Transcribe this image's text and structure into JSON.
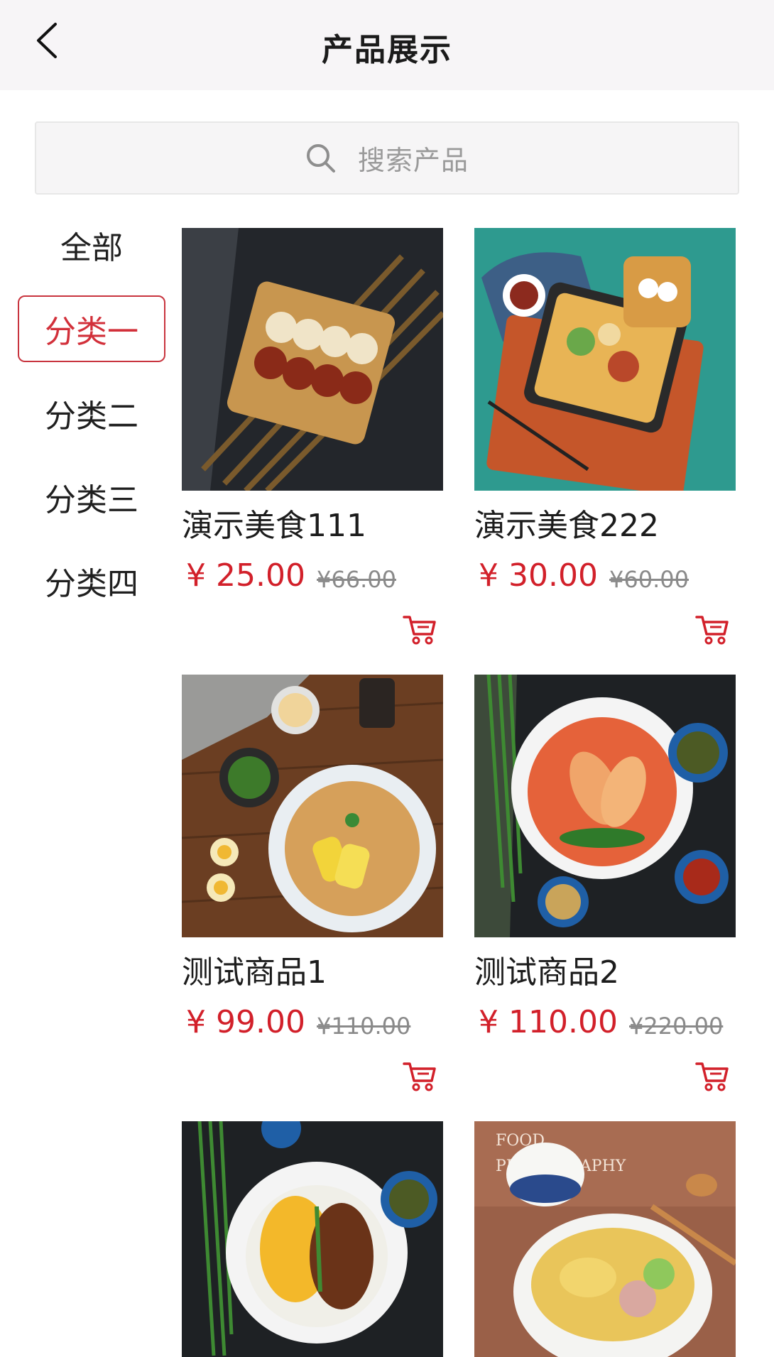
{
  "header": {
    "title": "产品展示"
  },
  "search": {
    "placeholder": "搜索产品"
  },
  "categories": [
    {
      "label": "全部",
      "active": false
    },
    {
      "label": "分类一",
      "active": true
    },
    {
      "label": "分类二",
      "active": false
    },
    {
      "label": "分类三",
      "active": false
    },
    {
      "label": "分类四",
      "active": false
    }
  ],
  "products": [
    {
      "name": "演示美食111",
      "price": "¥ 25.00",
      "original_price": "¥66.00",
      "image": "sushi-platter"
    },
    {
      "name": "演示美食222",
      "price": "¥ 30.00",
      "original_price": "¥60.00",
      "image": "bento-box"
    },
    {
      "name": "测试商品1",
      "price": "¥ 99.00",
      "original_price": "¥110.00",
      "image": "fried-rice"
    },
    {
      "name": "测试商品2",
      "price": "¥ 110.00",
      "original_price": "¥220.00",
      "image": "noodle-bowl"
    },
    {
      "name": "",
      "price": "",
      "original_price": "",
      "image": "corn-noodle-bowl"
    },
    {
      "name": "",
      "price": "",
      "original_price": "",
      "image": "dumpling-soup"
    }
  ],
  "image_text": {
    "food_photography": [
      "FOOD",
      "PHOTOGRAPHY"
    ]
  },
  "colors": {
    "accent": "#d2202a",
    "header_bg": "#f7f5f7",
    "active_border": "#c8343e"
  }
}
